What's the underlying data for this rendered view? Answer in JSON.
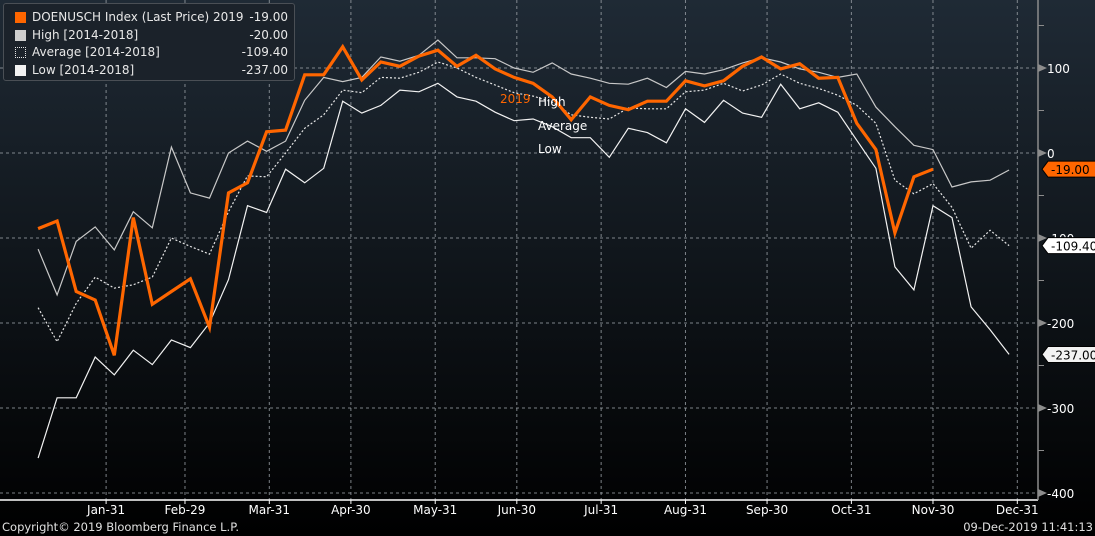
{
  "chart_data": {
    "type": "line",
    "x_axis": {
      "type": "date",
      "tick_labels": [
        "Jan-31",
        "Feb-29",
        "Mar-31",
        "Apr-30",
        "May-31",
        "Jun-30",
        "Jul-31",
        "Aug-31",
        "Sep-30",
        "Oct-31",
        "Nov-30",
        "Dec-31"
      ],
      "range": [
        "01-01",
        "12-31"
      ]
    },
    "y_axis": {
      "position": "right",
      "tick_labels": [
        "100",
        "0",
        "-100",
        "-200",
        "-300",
        "-400"
      ],
      "ticks": [
        100,
        0,
        -100,
        -200,
        -300,
        -400
      ],
      "range": [
        -410,
        150
      ]
    },
    "grid": true,
    "legend_placement": "top-left",
    "x": [
      "01-06",
      "01-13",
      "01-20",
      "01-27",
      "02-03",
      "02-10",
      "02-17",
      "02-24",
      "03-02",
      "03-09",
      "03-16",
      "03-23",
      "03-30",
      "04-06",
      "04-13",
      "04-20",
      "04-27",
      "05-04",
      "05-11",
      "05-18",
      "05-25",
      "06-01",
      "06-08",
      "06-15",
      "06-22",
      "06-29",
      "07-06",
      "07-13",
      "07-20",
      "07-27",
      "08-03",
      "08-10",
      "08-17",
      "08-24",
      "08-31",
      "09-07",
      "09-14",
      "09-21",
      "09-28",
      "10-05",
      "10-12",
      "10-19",
      "10-26",
      "11-02",
      "11-09",
      "11-16",
      "11-23",
      "11-30",
      "12-07",
      "12-14",
      "12-21",
      "12-28"
    ],
    "series": [
      {
        "name": "DOENUSCH Index (Last Price) 2019",
        "last_value": "-19.00",
        "color": "#ff6600",
        "style": "solid-thick",
        "tag_label": "-19.00",
        "annotation": "2019",
        "values": [
          -89,
          -80,
          -163,
          -173,
          -238,
          -76,
          -178,
          -163,
          -148,
          -205,
          -47,
          -35,
          25,
          27,
          92,
          92,
          125,
          86,
          107,
          102,
          114,
          121,
          102,
          115,
          99,
          89,
          82,
          66,
          39,
          66,
          56,
          51,
          61,
          61,
          85,
          79,
          85,
          102,
          113,
          99,
          105,
          88,
          89,
          35,
          4,
          -94,
          -28,
          -19
        ]
      },
      {
        "name": "High [2014-2018]",
        "last_value": "-20.00",
        "color": "#c8c8c8",
        "style": "solid",
        "annotation": "High",
        "values": [
          -113,
          -167,
          -104,
          -87,
          -114,
          -69,
          -88,
          7,
          -47,
          -53,
          0,
          14,
          2,
          14,
          62,
          89,
          84,
          89,
          113,
          108,
          115,
          133,
          112,
          112,
          111,
          100,
          95,
          106,
          93,
          88,
          82,
          81,
          88,
          77,
          96,
          93,
          98,
          106,
          112,
          107,
          99,
          95,
          89,
          93,
          54,
          31,
          9,
          4,
          -40,
          -34,
          -32,
          -20
        ]
      },
      {
        "name": "Average [2014-2018]",
        "last_value": "-109.40",
        "color": "#e6e6e6",
        "style": "dotted",
        "tag_label": "-109.40",
        "annotation": "Average",
        "values": [
          -182,
          -222,
          -177,
          -146,
          -159,
          -155,
          -146,
          -100,
          -110,
          -119,
          -69,
          -27,
          -28,
          0,
          29,
          45,
          74,
          71,
          89,
          88,
          95,
          107,
          100,
          89,
          80,
          71,
          67,
          60,
          45,
          42,
          40,
          53,
          52,
          52,
          72,
          74,
          82,
          73,
          80,
          93,
          82,
          76,
          68,
          56,
          35,
          -32,
          -48,
          -36,
          -64,
          -112,
          -91,
          -109
        ]
      },
      {
        "name": "Low [2014-2018]",
        "last_value": "-237.00",
        "color": "#f2f2f2",
        "style": "solid",
        "tag_label": "-237.00",
        "annotation": "Low",
        "values": [
          -359,
          -288,
          -288,
          -240,
          -261,
          -232,
          -249,
          -220,
          -229,
          -200,
          -149,
          -62,
          -70,
          -19,
          -35,
          -18,
          61,
          47,
          56,
          74,
          72,
          82,
          66,
          61,
          48,
          38,
          40,
          31,
          18,
          18,
          -5,
          29,
          24,
          12,
          52,
          36,
          62,
          47,
          42,
          81,
          52,
          59,
          48,
          15,
          -18,
          -134,
          -161,
          -62,
          -76,
          -181,
          -208,
          -237
        ]
      }
    ]
  },
  "footer": {
    "copyright": "Copyright© 2019 Bloomberg Finance L.P.",
    "timestamp": "09-Dec-2019 11:41:13"
  },
  "colors": {
    "background_top": "#1f2a35",
    "background_bottom": "#000000",
    "accent": "#ff6600"
  }
}
